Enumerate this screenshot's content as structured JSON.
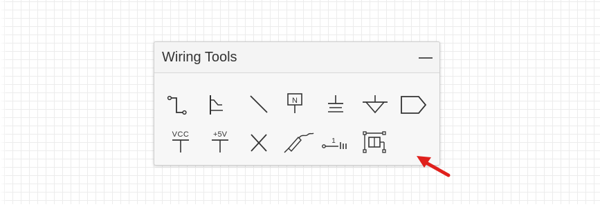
{
  "panel": {
    "title": "Wiring Tools",
    "minimize_icon": "minus-icon"
  },
  "tools": [
    {
      "name": "wire-tool",
      "icon": "wire-icon"
    },
    {
      "name": "bus-entry-tool",
      "icon": "bus-entry-icon"
    },
    {
      "name": "line-tool",
      "icon": "diagonal-line-icon"
    },
    {
      "name": "net-label-tool",
      "icon": "net-label-icon",
      "label": "N"
    },
    {
      "name": "ground-tool",
      "icon": "ground-icon"
    },
    {
      "name": "signal-ground-tool",
      "icon": "signal-ground-icon"
    },
    {
      "name": "port-tool",
      "icon": "port-icon"
    },
    {
      "name": "vcc-tool",
      "icon": "vcc-icon",
      "label": "VCC"
    },
    {
      "name": "plus5v-tool",
      "icon": "plus5v-icon",
      "label": "+5V"
    },
    {
      "name": "no-connect-tool",
      "icon": "no-connect-icon"
    },
    {
      "name": "probe-tool",
      "icon": "probe-icon"
    },
    {
      "name": "pin-tool",
      "icon": "pin-icon",
      "label": "1"
    },
    {
      "name": "net-port-tool",
      "icon": "net-port-icon"
    }
  ],
  "colors": {
    "icon_stroke": "#333333",
    "pointer_arrow": "#e0201c",
    "panel_background": "#f7f7f7",
    "grid_line": "#ececec"
  }
}
